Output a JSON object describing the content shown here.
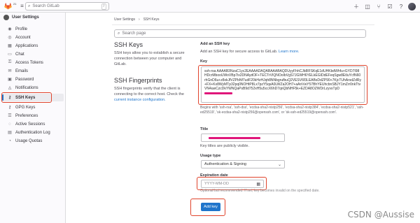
{
  "topbar": {
    "badge": "21",
    "search_placeholder": "Search GitLab",
    "shortcut": "/"
  },
  "sidebar": {
    "title": "User Settings",
    "items": [
      {
        "label": "Profile",
        "icon": "profile-icon"
      },
      {
        "label": "Account",
        "icon": "account-icon"
      },
      {
        "label": "Applications",
        "icon": "applications-icon"
      },
      {
        "label": "Chat",
        "icon": "chat-icon"
      },
      {
        "label": "Access Tokens",
        "icon": "token-icon"
      },
      {
        "label": "Emails",
        "icon": "mail-icon"
      },
      {
        "label": "Password",
        "icon": "lock-icon"
      },
      {
        "label": "Notifications",
        "icon": "bell-icon"
      },
      {
        "label": "SSH Keys",
        "icon": "key-icon"
      },
      {
        "label": "GPG Keys",
        "icon": "key-icon"
      },
      {
        "label": "Preferences",
        "icon": "preferences-icon"
      },
      {
        "label": "Active Sessions",
        "icon": "sessions-icon"
      },
      {
        "label": "Authentication Log",
        "icon": "log-icon"
      },
      {
        "label": "Usage Quotas",
        "icon": "quota-icon"
      }
    ]
  },
  "breadcrumb": {
    "parent": "User Settings",
    "current": "SSH Keys"
  },
  "search": {
    "placeholder": "Search page"
  },
  "ssh": {
    "title": "SSH Keys",
    "description": "SSH keys allow you to establish a secure connection between your computer and GitLab."
  },
  "fingerprints": {
    "title": "SSH Fingerprints",
    "description": "SSH fingerprints verify that the client is connecting to the correct host. Check the",
    "link": "current instance configuration."
  },
  "form": {
    "heading": "Add an SSH key",
    "subtitle": "Add an SSH key for secure access to GitLab.",
    "learn_more": "Learn more.",
    "key_label": "Key",
    "key_value": "ssh-rsa AAAAB3NzaC1yc2EAAAADAQABAAABAQDUyyFhhCJb8IFSKqE1dUHKbdWhfu+GYD7I98HDcrMbooUWoVBp7ix2DNAydOF+TECTrVIQNOoIbVgS7JGWH6YELkEGIDdEFeqSgw8EtIuYcfN60rhGnD6u+z8xkJfVZPbNf7udF20kHzHJqh8NNbgrufbuQ2VESV6f3LEABsDdZP90+7KjcTUhArsdZdRy+FX+Kx8WyMTp32pq0NOHtP8Lx7pzY5qsA0LWZa2OH7+aAnVwY57BhYEUhcbnSBJY1mZrr0nkTtvVN4uwCzcDkYWNQaPsB9d752xH5u5ccX6hD7qnQbNHF5k+EZDA8OZWDrLzyvsTpD",
    "help": "Begins with 'ssh-rsa', 'ssh-dss', 'ecdsa-sha2-nistp256', 'ecdsa-sha2-nistp384', 'ecdsa-sha2-nistp521', 'ssh-ed25519', 'sk-ecdsa-sha2-nistp256@openssh.com', or 'sk-ssh-ed25519@openssh.com'.",
    "title_label": "Title",
    "title_help": "Key titles are publicly visible.",
    "usage_label": "Usage type",
    "usage_value": "Authentication & Signing",
    "expiration_label": "Expiration date",
    "date_placeholder": "YYYY-MM-DD",
    "date_help": "Optional but recommended. If set, key becomes invalid on the specified date.",
    "add_button": "Add key"
  },
  "watermark": "CSDN @Aussise",
  "colors": {
    "accent": "#1f75cb",
    "highlight": "#e0442c",
    "redaction": "#e0167a"
  }
}
